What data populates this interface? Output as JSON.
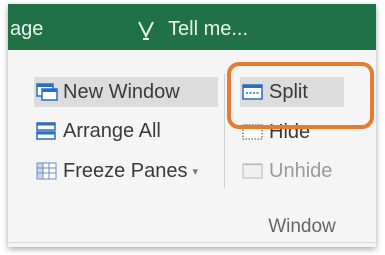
{
  "ribbon_top": {
    "partial_tab": "age",
    "tell_me": "Tell me...",
    "bulb_icon": "lightbulb-icon"
  },
  "buttons": {
    "new_window": "New Window",
    "arrange_all": "Arrange All",
    "freeze_panes": "Freeze Panes",
    "split": "Split",
    "hide": "Hide",
    "unhide": "Unhide"
  },
  "group": {
    "label": "Window"
  },
  "colors": {
    "ribbon_green": "#207246",
    "highlight_orange": "#e87b2e",
    "icon_blue": "#2b6cc4"
  }
}
